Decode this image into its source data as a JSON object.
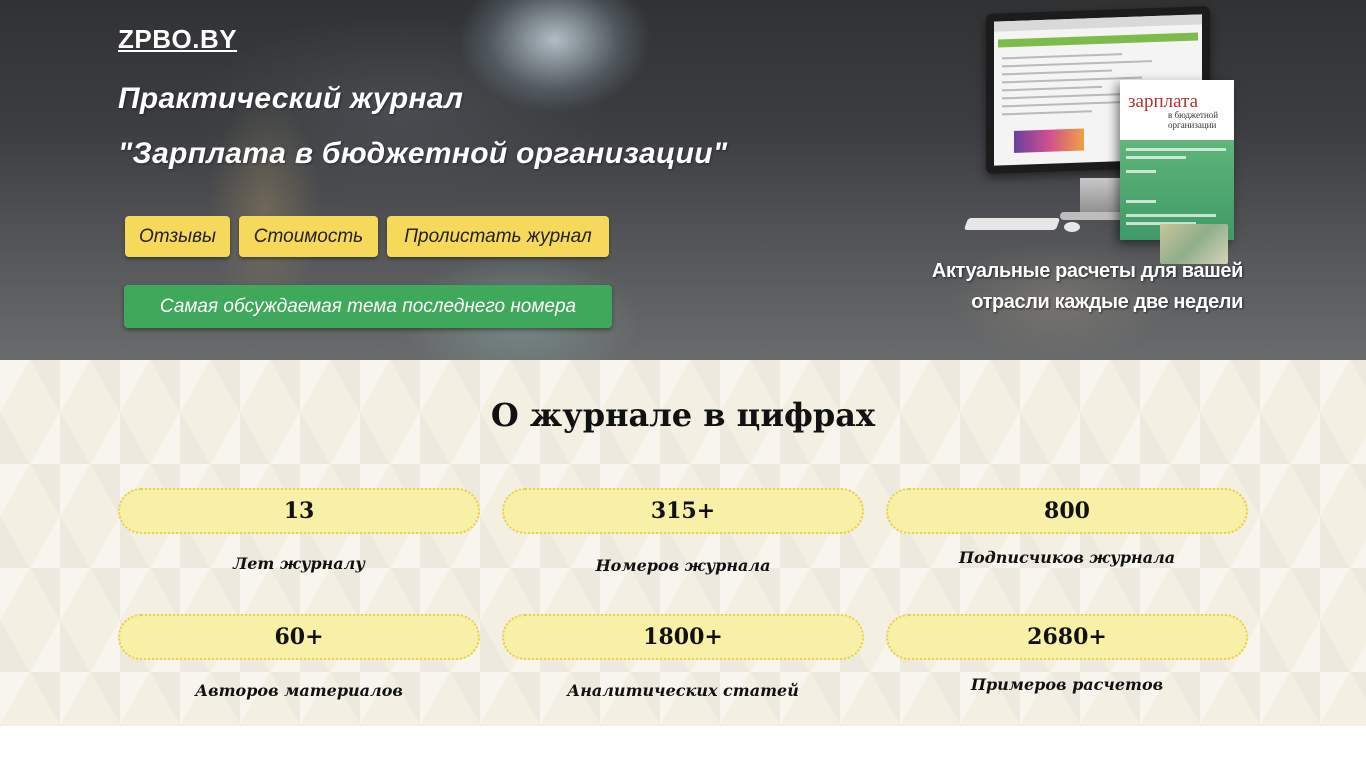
{
  "hero": {
    "logo": "ZPBO.BY",
    "title_line1": "Практический журнал",
    "title_line2": "\"Зарплата в бюджетной организации\"",
    "buttons": [
      "Отзывы",
      "Стоимость",
      "Пролистать журнал"
    ],
    "cta": "Самая обсуждаемая тема последнего номера",
    "tagline_line1": "Актуальные расчеты для вашей",
    "tagline_line2": "отрасли каждые две недели",
    "magazine_cover_title": "зарплата",
    "magazine_cover_subtitle": "в бюджетной организации"
  },
  "stats": {
    "title": "О журнале в цифрах",
    "items": [
      {
        "value": "13",
        "label": "Лет журналу"
      },
      {
        "value": "315+",
        "label": "Номеров журнала"
      },
      {
        "value": "800",
        "label": "Подписчиков журнала"
      },
      {
        "value": "60+",
        "label": "Авторов материалов"
      },
      {
        "value": "1800+",
        "label": "Аналитических статей"
      },
      {
        "value": "2680+",
        "label": "Примеров расчетов"
      }
    ]
  },
  "colors": {
    "button_yellow": "#f6d95a",
    "button_green": "#3fa85a",
    "pill_fill": "#f7f0a6",
    "pill_border": "#e7cf55"
  }
}
